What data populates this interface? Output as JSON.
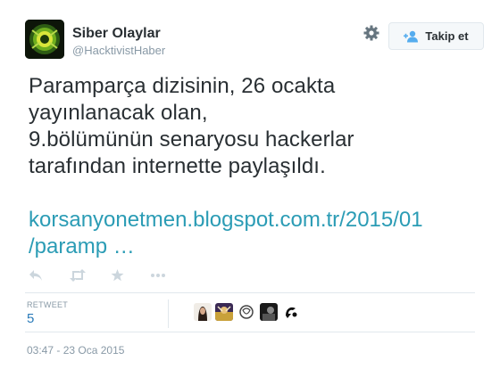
{
  "user": {
    "fullname": "Siber Olaylar",
    "username": "@HacktivistHaber"
  },
  "actions": {
    "follow_label": "Takip et"
  },
  "tweet": {
    "text_lines": [
      "Paramparça dizisinin, 26 ocakta",
      "yayınlanacak olan,",
      "9.bölümünün senaryosu hackerlar",
      "tarafından internette paylaşıldı."
    ],
    "link_lines": [
      "korsanyonetmen.blogspot.com.tr/2015/01",
      "/paramp …"
    ]
  },
  "stats": {
    "retweet_label": "RETWEET",
    "retweet_count": "5"
  },
  "timestamp": "03:47 - 23 Oca 2015",
  "icons": [
    "gear-icon",
    "follow-user-icon",
    "reply-icon",
    "retweet-icon",
    "favorite-icon",
    "more-icon"
  ],
  "colors": {
    "link": "#2b9cb5",
    "count": "#2b7bb9",
    "muted": "#8899a6",
    "text": "#292f33",
    "action_icon": "#ccd6dd"
  }
}
